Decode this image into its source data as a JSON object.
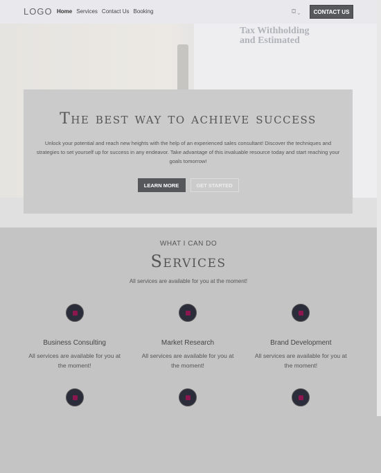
{
  "header": {
    "logo": "LOGO",
    "nav": [
      "Home",
      "Services",
      "Contact Us",
      "Booking"
    ],
    "lang_icon": "flag-icon",
    "contact_label": "CONTACT US"
  },
  "hero": {
    "background_text": "Tax Withholding and Estimated",
    "title": "The best way to achieve success",
    "text": "Unlock your potential and reach new heights with the help of an experienced sales consultant! Discover the techniques and strategies to set yourself up for success in any endeavor. Take advantage of this invaluable resource today and start reaching your goals tomorrow!",
    "learn_more": "LEARN MORE",
    "get_started": "GET STARTED"
  },
  "services": {
    "eyebrow": "WHAT I CAN DO",
    "title": "Services",
    "subtitle": "All services are available for you at the moment!",
    "items": [
      {
        "title": "Business Consulting",
        "text": "All services are available for you at the moment!"
      },
      {
        "title": "Market Research",
        "text": "All services are available for you at the moment!"
      },
      {
        "title": "Brand Development",
        "text": "All services are available for you at the moment!"
      },
      {
        "title": "",
        "text": ""
      },
      {
        "title": "",
        "text": ""
      },
      {
        "title": "",
        "text": ""
      }
    ]
  },
  "colors": {
    "button_dark": "#55575b",
    "services_bg": "#c4c4c4",
    "header_bg": "#e9e8ec"
  }
}
